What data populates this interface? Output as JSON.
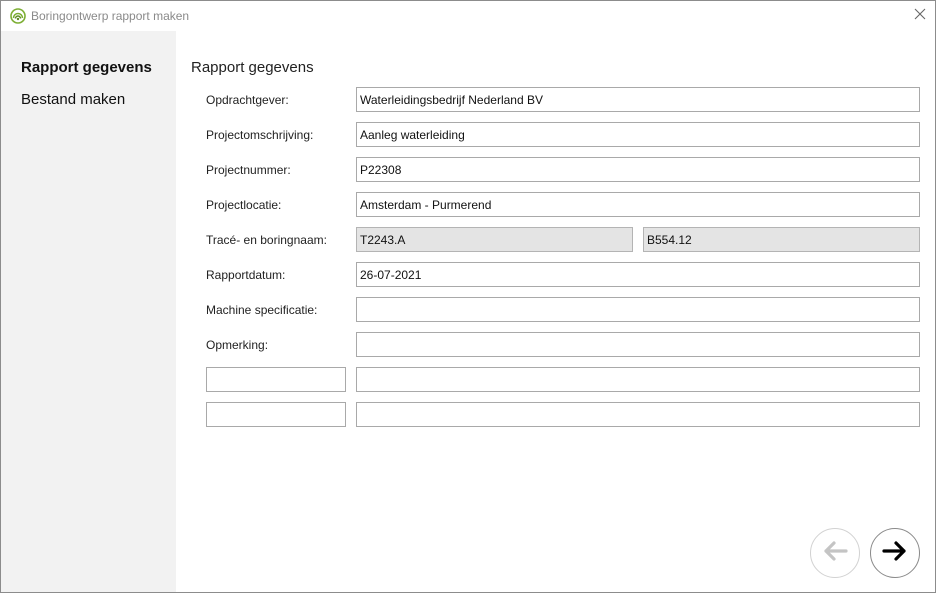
{
  "window": {
    "title": "Boringontwerp rapport maken",
    "icon": "app-logo-icon",
    "close_icon": "close-icon"
  },
  "sidebar": {
    "items": [
      {
        "label": "Rapport gegevens",
        "active": true
      },
      {
        "label": "Bestand maken",
        "active": false
      }
    ]
  },
  "main": {
    "section_title": "Rapport gegevens",
    "fields": {
      "opdrachtgever": {
        "label": "Opdrachtgever:",
        "value": "Waterleidingsbedrijf Nederland BV"
      },
      "projectomschrijving": {
        "label": "Projectomschrijving:",
        "value": "Aanleg waterleiding"
      },
      "projectnummer": {
        "label": "Projectnummer:",
        "value": "P22308"
      },
      "projectlocatie": {
        "label": "Projectlocatie:",
        "value": "Amsterdam - Purmerend"
      },
      "trace_boringnaam": {
        "label": "Tracé- en boringnaam:",
        "trace_value": "T2243.A",
        "boring_value": "B554.12"
      },
      "rapportdatum": {
        "label": "Rapportdatum:",
        "value": "26-07-2021"
      },
      "machine_specificatie": {
        "label": "Machine specificatie:",
        "value": ""
      },
      "opmerking": {
        "label": "Opmerking:",
        "value": ""
      },
      "custom_1": {
        "label_value": "",
        "value": ""
      },
      "custom_2": {
        "label_value": "",
        "value": ""
      }
    }
  },
  "navigation": {
    "back_icon": "arrow-left-icon",
    "next_icon": "arrow-right-icon",
    "back_enabled": false
  }
}
